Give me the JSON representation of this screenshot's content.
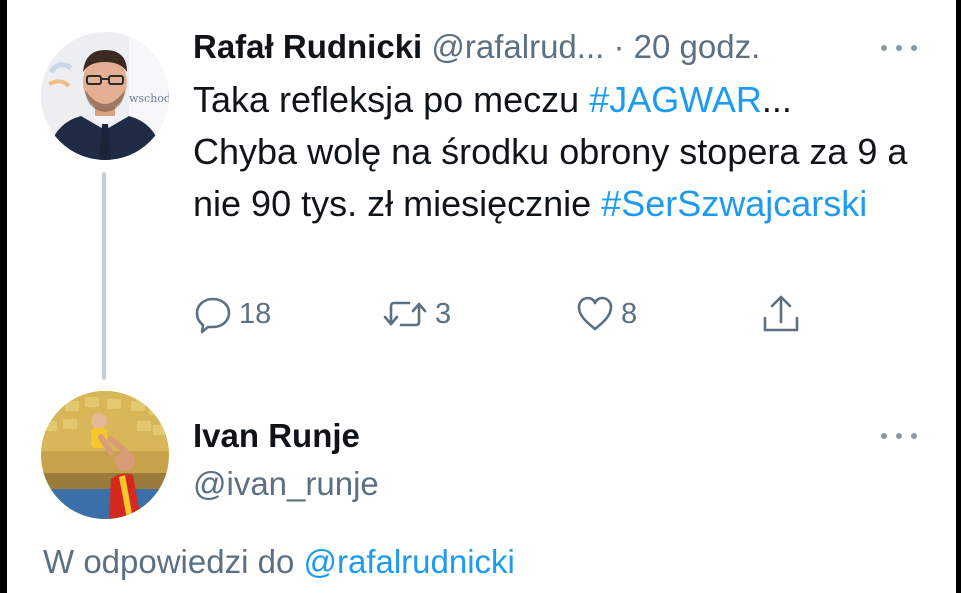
{
  "tweet": {
    "author_name": "Rafał Rudnicki",
    "author_handle": "@rafalrud...",
    "separator": "·",
    "time": "20 godz.",
    "text_prefix": "Taka refleksja po meczu ",
    "hashtag_1": "#JAGWAR",
    "text_middle": "...\nChyba wolę na środku obrony stopera za 9 a nie 90 tys. zł miesięcznie ",
    "hashtag_2": "#SerSzwajcarski",
    "avatar_caption": "wschod",
    "counts": {
      "replies": "18",
      "retweets": "3",
      "likes": "8"
    }
  },
  "reply": {
    "author_name": "Ivan Runje",
    "author_handle": "@ivan_runje",
    "context_prefix": "W odpowiedzi do ",
    "context_handle": "@rafalrudnicki"
  },
  "colors": {
    "link": "#1d9bf0",
    "text_primary": "#0f1419",
    "text_secondary": "#5b7083",
    "thread_line": "#c4cfd6",
    "jersey_red": "#d5291f",
    "jersey_yellow": "#f4c82a"
  },
  "icons": {
    "reply": "reply-icon",
    "retweet": "retweet-icon",
    "like": "like-icon",
    "share": "share-icon",
    "more": "more-icon"
  }
}
